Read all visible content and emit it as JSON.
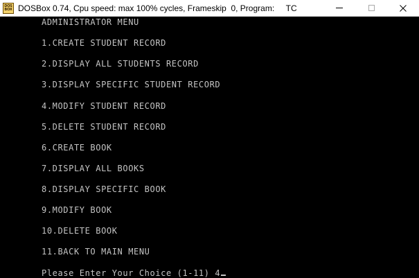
{
  "window": {
    "app_icon_label_top": "DOS",
    "app_icon_label_bottom": "BOX",
    "title": "DOSBox 0.74, Cpu speed: max 100% cycles, Frameskip  0, Program:     TC"
  },
  "console": {
    "heading": "ADMINISTRATOR MENU",
    "menu_items": [
      "1.CREATE STUDENT RECORD",
      "2.DISPLAY ALL STUDENTS RECORD",
      "3.DISPLAY SPECIFIC STUDENT RECORD",
      "4.MODIFY STUDENT RECORD",
      "5.DELETE STUDENT RECORD",
      "6.CREATE BOOK",
      "7.DISPLAY ALL BOOKS",
      "8.DISPLAY SPECIFIC BOOK",
      "9.MODIFY BOOK",
      "10.DELETE BOOK",
      "11.BACK TO MAIN MENU"
    ],
    "prompt": "Please Enter Your Choice (1-11) 4"
  },
  "colors": {
    "console_text": "#c4c4c4",
    "console_background": "#000000",
    "titlebar_background": "#ffffff"
  }
}
